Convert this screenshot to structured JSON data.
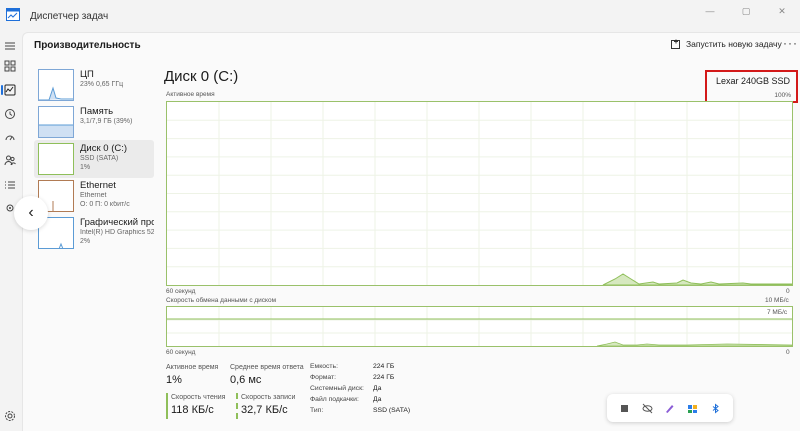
{
  "window": {
    "title": "Диспетчер задач",
    "minimize": "—",
    "maximize": "▢",
    "close": "✕"
  },
  "header": {
    "title": "Производительность",
    "run_task": "Запустить новую задачу",
    "more": "···"
  },
  "devices": [
    {
      "name": "ЦП",
      "sub1": "23%  0,65 ГГц",
      "sub2": ""
    },
    {
      "name": "Память",
      "sub1": "3,1/7,9 ГБ (39%)",
      "sub2": ""
    },
    {
      "name": "Диск 0 (C:)",
      "sub1": "SSD (SATA)",
      "sub2": "1%"
    },
    {
      "name": "Ethernet",
      "sub1": "Ethernet",
      "sub2": "О: 0  П: 0 кбит/с"
    },
    {
      "name": "Графический про",
      "sub1": "Intel(R) HD Graphics 520",
      "sub2": "2%"
    }
  ],
  "disk": {
    "title": "Диск 0 (C:)",
    "model": "Lexar 240GB SSD",
    "pct_label": "100%",
    "active_time_label": "Активное время",
    "time_span": "60 секунд",
    "zero": "0",
    "transfer_label": "Скорость обмена данными с диском",
    "transfer_max": "10 МБ/с",
    "transfer_mark": "7 МБ/с"
  },
  "stats": {
    "active_time": {
      "label": "Активное время",
      "value": "1%"
    },
    "avg_response": {
      "label": "Среднее время ответа",
      "value": "0,6 мс"
    },
    "read_speed": {
      "label": "Скорость чтения",
      "value": "118 КБ/с"
    },
    "write_speed": {
      "label": "Скорость записи",
      "value": "32,7 КБ/с"
    }
  },
  "properties": [
    {
      "key": "Емкость:",
      "value": "224 ГБ"
    },
    {
      "key": "Формат:",
      "value": "224 ГБ"
    },
    {
      "key": "Системный диск:",
      "value": "Да"
    },
    {
      "key": "Файл подкачки:",
      "value": "Да"
    },
    {
      "key": "Тип:",
      "value": "SSD (SATA)"
    }
  ],
  "colors": {
    "accent": "#1e6fd9",
    "disk_graph": "#8fbf5a",
    "highlight": "#d31919"
  },
  "icons": {
    "rail": [
      "hamburger-icon",
      "processes-icon",
      "performance-icon",
      "history-icon",
      "startup-icon",
      "users-icon",
      "details-icon",
      "services-icon",
      "settings-icon"
    ],
    "tray": [
      "stop-icon",
      "hide-icon",
      "pen-icon",
      "app-icon",
      "bluetooth-icon"
    ]
  }
}
